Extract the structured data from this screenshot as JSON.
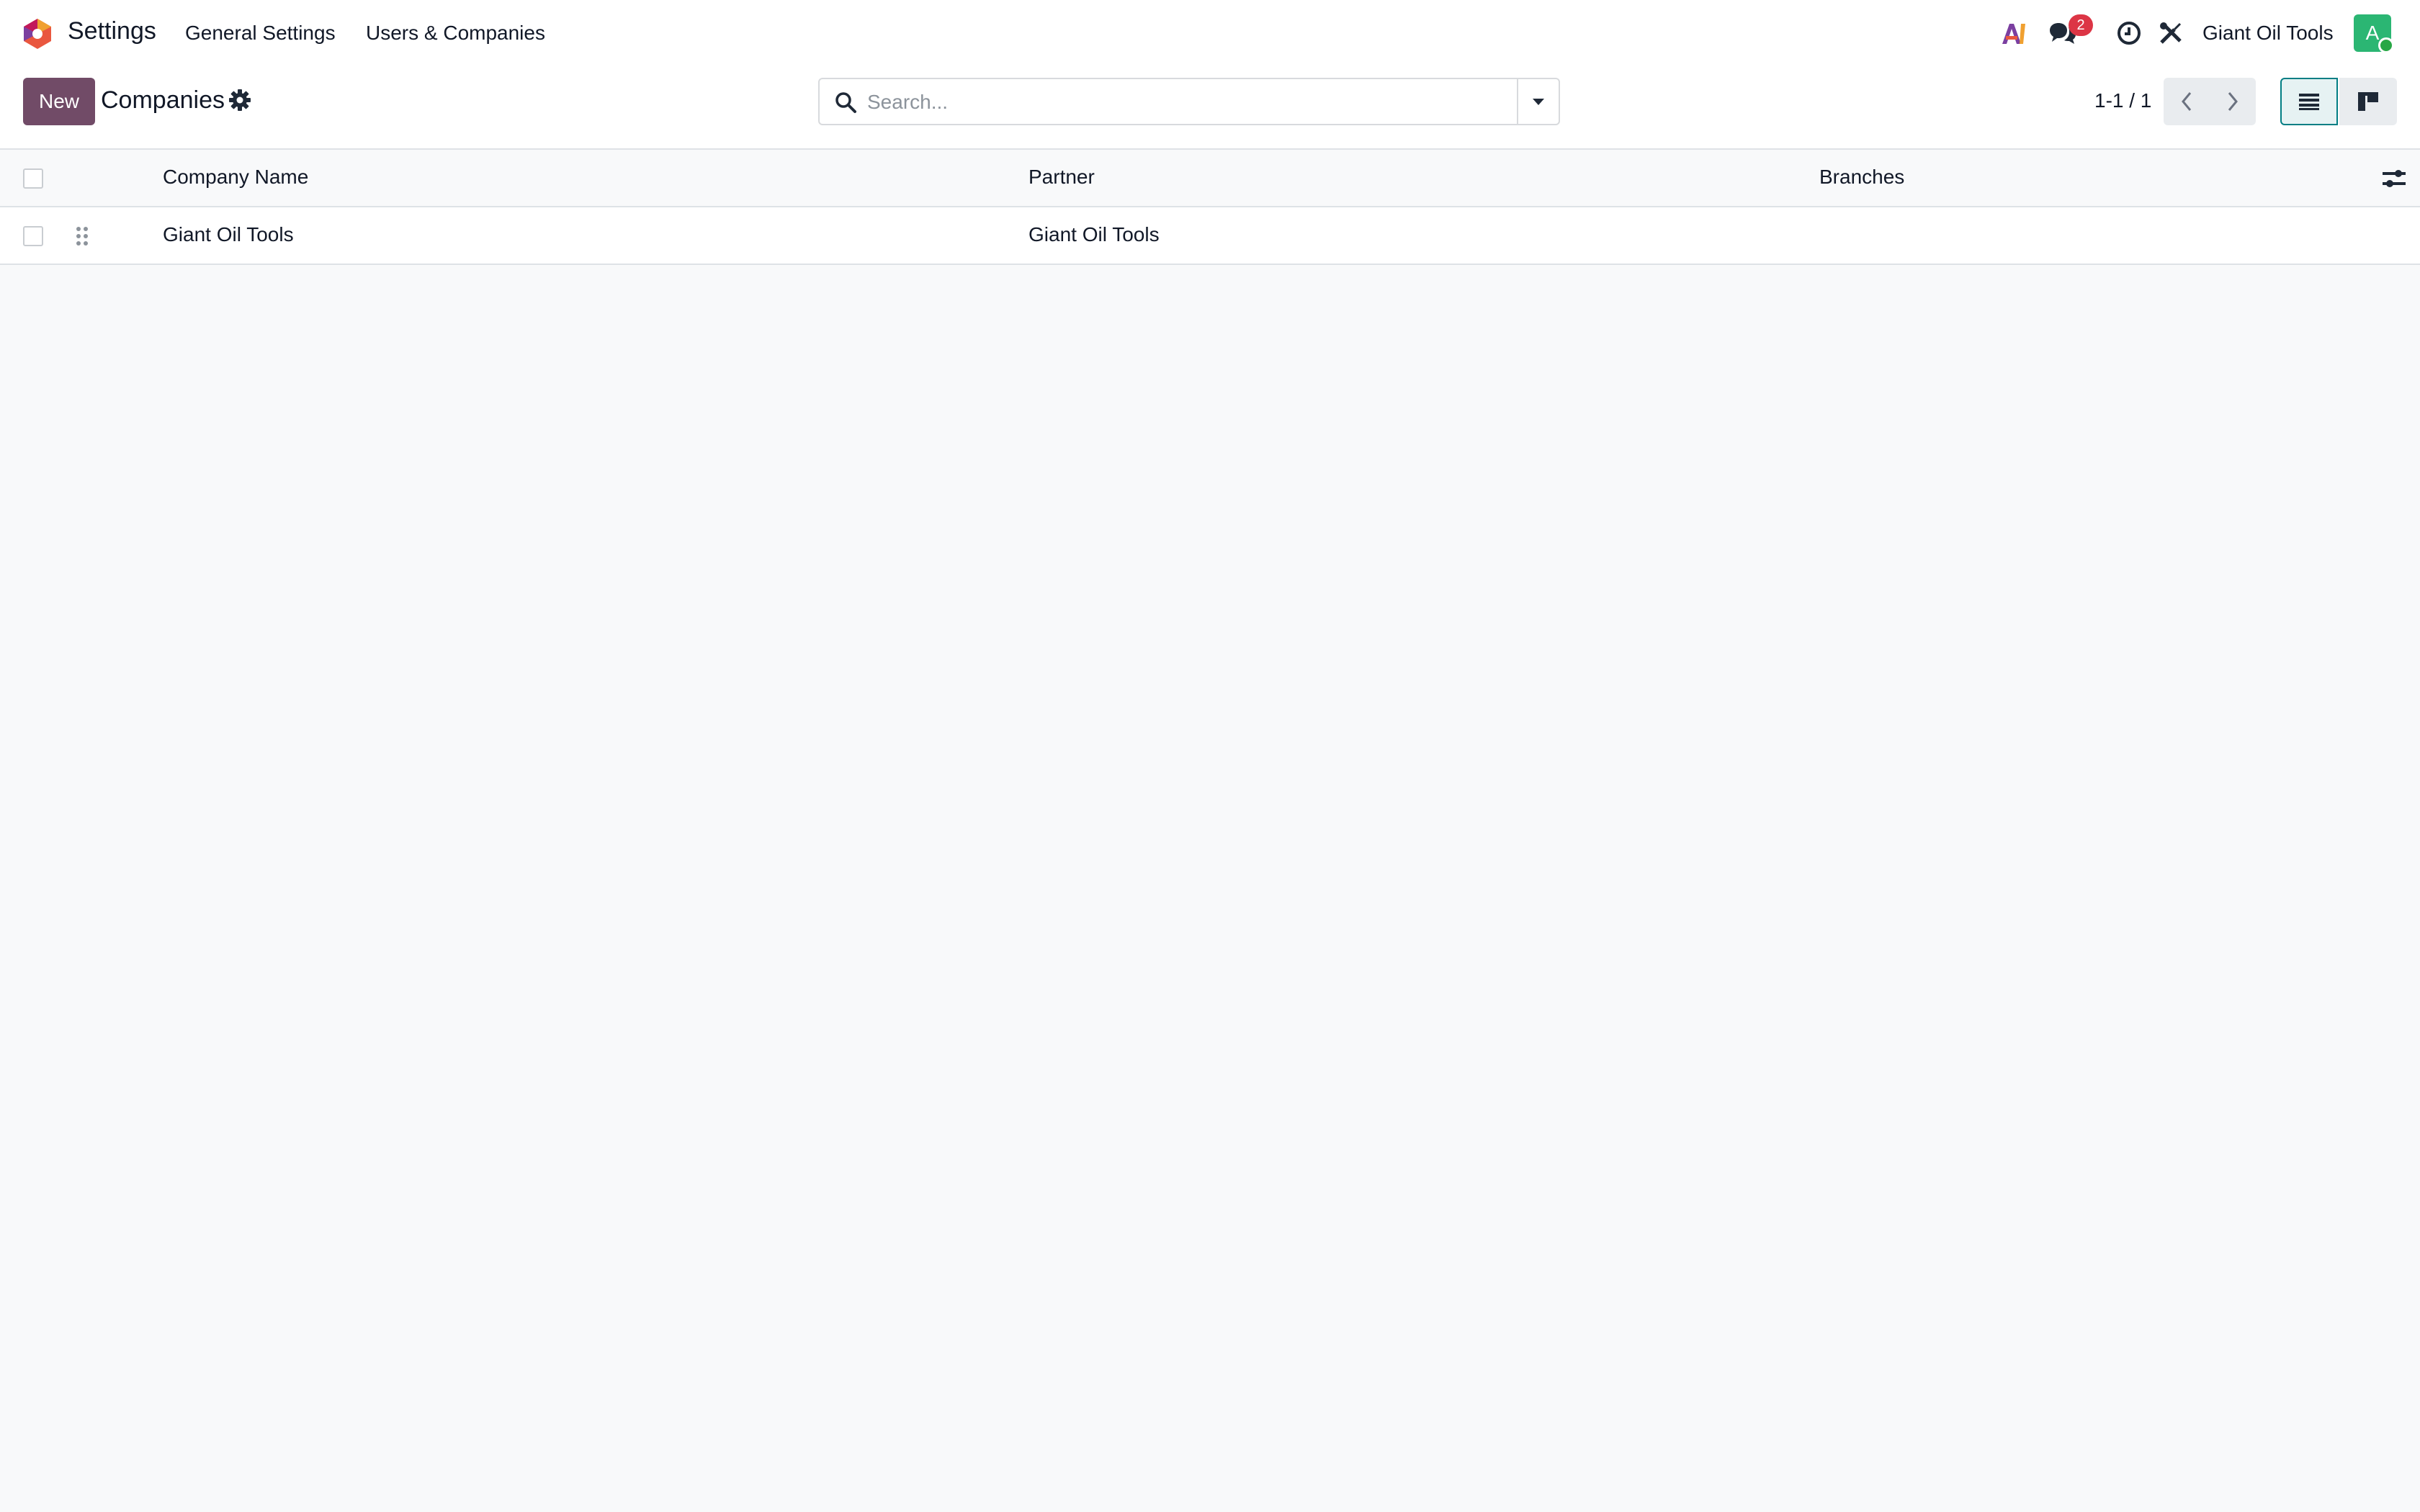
{
  "navbar": {
    "app_name": "Settings",
    "menu": [
      {
        "label": "General Settings"
      },
      {
        "label": "Users & Companies"
      }
    ],
    "icons": [
      "ai-icon",
      "messages-icon",
      "activity-clock-icon",
      "debug-tools-icon"
    ],
    "messages_badge": "2",
    "company": "Giant Oil Tools",
    "avatar_letter": "A",
    "colors": {
      "avatar": "#2bb673",
      "badge": "#dc3545",
      "status_online": "#28a745"
    }
  },
  "control_panel": {
    "new_label": "New",
    "breadcrumb": "Companies",
    "search_placeholder": "Search...",
    "pager": "1-1 / 1",
    "colors": {
      "new_button": "#714b67",
      "active_view": "#017e84"
    }
  },
  "table": {
    "columns": [
      "Company Name",
      "Partner",
      "Branches"
    ],
    "rows": [
      {
        "company_name": "Giant Oil Tools",
        "partner": "Giant Oil Tools",
        "branches": ""
      }
    ]
  }
}
